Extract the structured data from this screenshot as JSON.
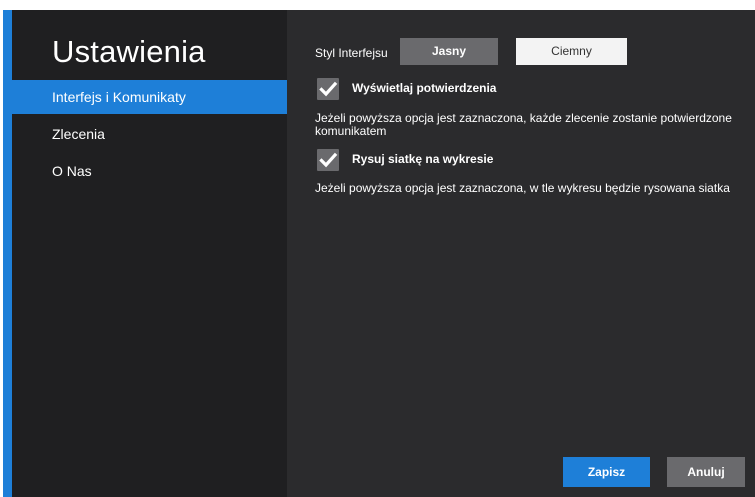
{
  "colors": {
    "accent": "#1e7fd8",
    "sidebar_bg": "#1f1f21",
    "content_bg": "#2b2b2d",
    "control_gray": "#6a6a6d",
    "light_button": "#f3f3f3"
  },
  "sidebar": {
    "title": "Ustawienia",
    "items": [
      {
        "label": "Interfejs i Komunikaty",
        "active": true
      },
      {
        "label": "Zlecenia",
        "active": false
      },
      {
        "label": "O Nas",
        "active": false
      }
    ]
  },
  "interface_style": {
    "label": "Styl Interfejsu",
    "options": [
      "Jasny",
      "Ciemny"
    ]
  },
  "options": [
    {
      "label": "Wyświetlaj potwierdzenia",
      "checked": true,
      "icon": "checkmark-icon",
      "description": "Jeżeli powyższa opcja jest zaznaczona, każde zlecenie zostanie potwierdzone komunikatem"
    },
    {
      "label": "Rysuj siatkę na wykresie",
      "checked": true,
      "icon": "checkmark-icon",
      "description": "Jeżeli powyższa opcja jest zaznaczona, w tle wykresu będzie rysowana siatka"
    }
  ],
  "footer": {
    "save_label": "Zapisz",
    "cancel_label": "Anuluj"
  }
}
